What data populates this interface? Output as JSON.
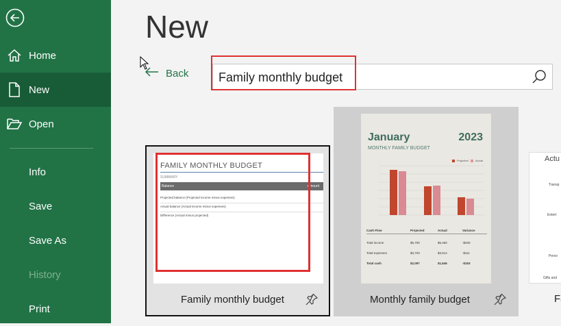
{
  "sidebar": {
    "items": [
      {
        "label": "Home",
        "icon": "home-icon"
      },
      {
        "label": "New",
        "icon": "new-document-icon"
      },
      {
        "label": "Open",
        "icon": "folder-open-icon"
      },
      {
        "label": "Info"
      },
      {
        "label": "Save"
      },
      {
        "label": "Save As"
      },
      {
        "label": "History"
      },
      {
        "label": "Print"
      }
    ]
  },
  "main": {
    "title": "New",
    "back_label": "Back",
    "search_value": "Family monthly budget"
  },
  "templates": [
    {
      "label": "Family monthly budget",
      "thumb_title": "FAMILY MONTHLY BUDGET",
      "thumb_section": "SUMMARY",
      "thumb_header_left": "Balance",
      "thumb_header_right": "Amount",
      "thumb_rows": [
        "Projected balance (Projected income minus expenses)",
        "Actual balance (Actual income minus expenses)",
        "Difference (Actual minus projected)"
      ]
    },
    {
      "label": "Monthly family budget",
      "thumb_month": "January",
      "thumb_year": "2023",
      "thumb_subtitle": "MONTHLY FAMILY BUDGET",
      "thumb_legend": [
        "Projected",
        "Actual"
      ],
      "thumb_table_headers": [
        "Cash Flow",
        "Projected",
        "Actual",
        "Variance"
      ],
      "thumb_table_rows": [
        [
          "Total income",
          "$5,700",
          "$5,460",
          "-$200"
        ],
        [
          "Total expenses",
          "$3,703",
          "$3,814",
          "-$111"
        ],
        [
          "Total cash",
          "$2,097",
          "$1,646",
          "-$153"
        ]
      ]
    },
    {
      "label": "Fa",
      "thumb_title": "Actu",
      "thumb_rows": [
        "Transp",
        "Entert",
        "Perso",
        "Gifts and"
      ]
    }
  ],
  "colors": {
    "sidebar": "#217346",
    "sidebar_active": "#185c37",
    "highlight": "#e03030"
  }
}
